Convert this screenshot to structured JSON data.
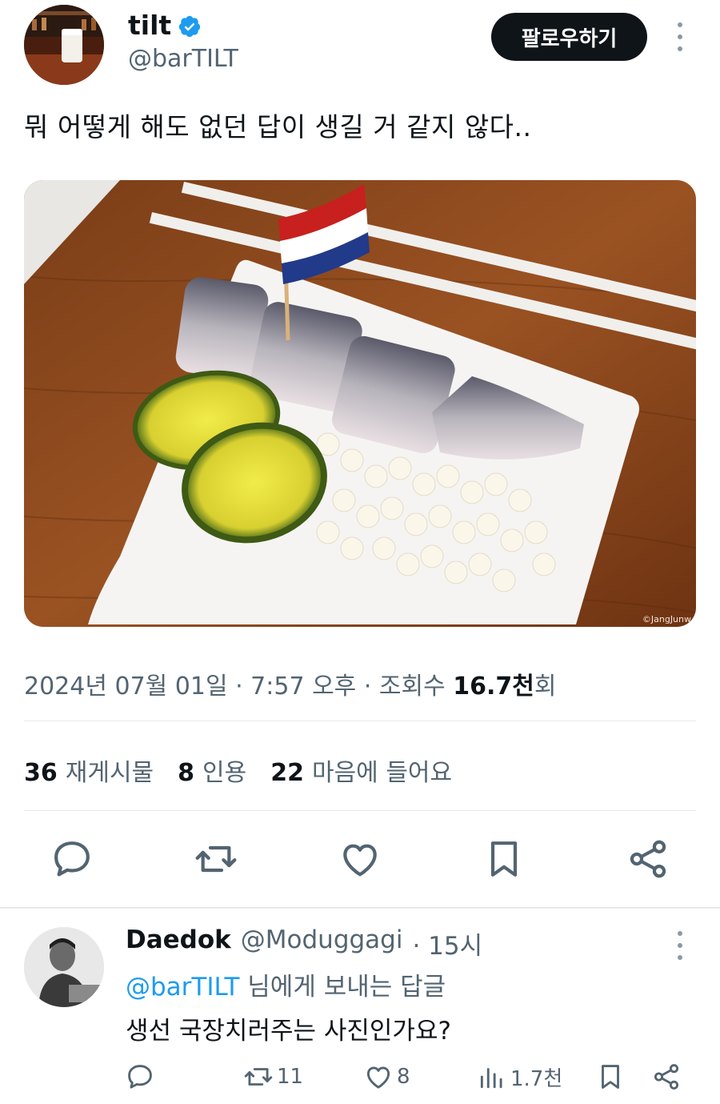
{
  "tweet": {
    "display_name": "tilt",
    "handle": "@barTILT",
    "follow_label": "팔로우하기",
    "text": "뭐 어떻게 해도 없던 답이 생길 거 같지 않다..",
    "photo_credit": "©JangJunw",
    "date": "2024년 07월 01일 · 7:57 오후 · 조회수 ",
    "views": "16.7천",
    "views_suffix": "회",
    "stats": {
      "reposts_count": "36",
      "reposts_label": "재게시물",
      "quotes_count": "8",
      "quotes_label": "인용",
      "likes_count": "22",
      "likes_label": "마음에 들어요"
    }
  },
  "reply": {
    "display_name": "Daedok",
    "handle": "@Moduggagi",
    "time": "· 15시",
    "reply_to_mention": "@barTILT",
    "reply_to_suffix": " 님에게 보내는 답글",
    "text": "생선 국장치러주는 사진인가요?",
    "retweets": "11",
    "likes": "8",
    "views": "1.7천"
  },
  "colors": {
    "accent": "#1d9bf0",
    "text": "#0f1419",
    "muted": "#536471",
    "divider": "#e6e9ec"
  },
  "icons": [
    "verified-badge-icon",
    "more-icon",
    "reply-icon",
    "retweet-icon",
    "like-icon",
    "bookmark-icon",
    "share-icon",
    "views-icon"
  ]
}
